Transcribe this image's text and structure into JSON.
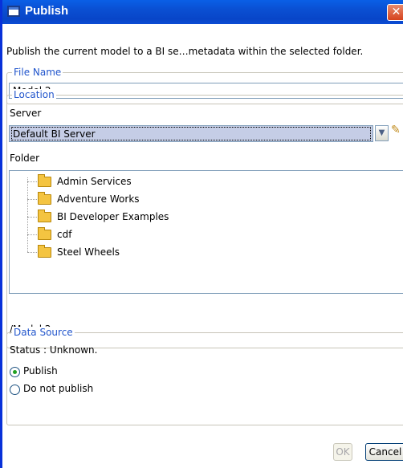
{
  "window": {
    "title": "Publish",
    "close_glyph": "✕"
  },
  "description": "Publish the current model to a BI se…metadata within the selected folder.",
  "file_name": {
    "legend": "File Name",
    "value": "Model 2"
  },
  "location": {
    "legend": "Location",
    "server_label": "Server",
    "server_value": "Default BI Server",
    "folder_label": "Folder",
    "folders": [
      {
        "label": "Admin Services"
      },
      {
        "label": "Adventure Works"
      },
      {
        "label": "BI Developer Examples"
      },
      {
        "label": "cdf"
      },
      {
        "label": "Steel Wheels"
      }
    ],
    "path": "/Model 2"
  },
  "data_source": {
    "legend": "Data Source",
    "status": "Status : Unknown.",
    "options": [
      {
        "label": "Publish",
        "checked": true
      },
      {
        "label": "Do not publish",
        "checked": false
      }
    ]
  },
  "buttons": {
    "ok": "OK",
    "cancel": "Cancel"
  },
  "icons": {
    "folder": "folder-icon",
    "edit": "pencil-icon",
    "dropdown": "chevron-down-icon"
  }
}
